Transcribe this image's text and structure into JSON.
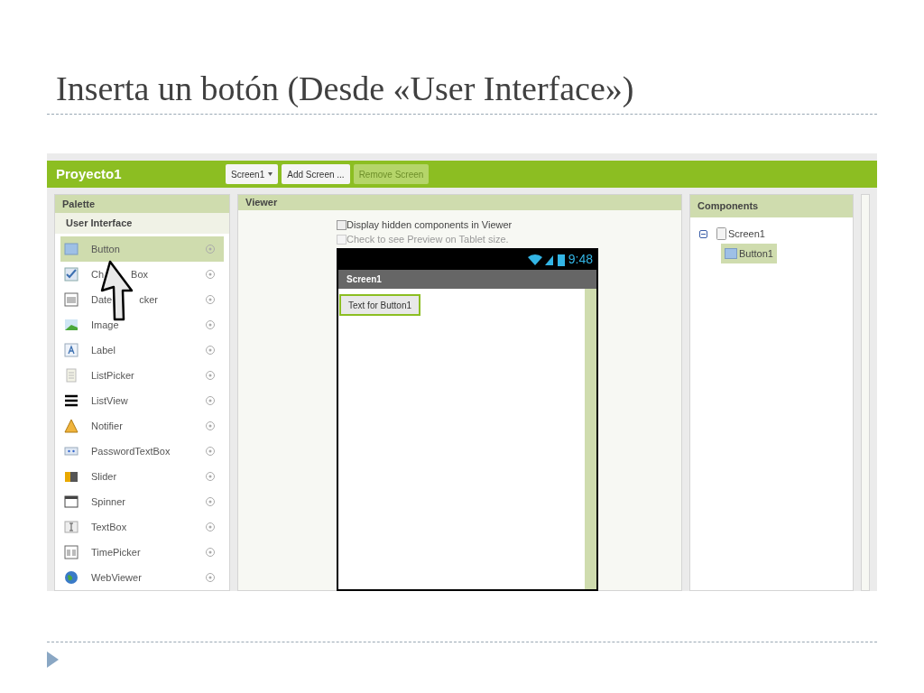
{
  "slide": {
    "title": "Inserta un botón (Desde «User Interface»)"
  },
  "app": {
    "project": "Proyecto1",
    "toolbar": [
      {
        "label": "Screen1",
        "kind": "dropdown",
        "disabled": false
      },
      {
        "label": "Add Screen ...",
        "kind": "button",
        "disabled": false
      },
      {
        "label": "Remove Screen",
        "kind": "button",
        "disabled": true
      }
    ],
    "palette": {
      "title": "Palette",
      "section": "User Interface",
      "items": [
        {
          "name": "Button",
          "kind": "button",
          "selected": true
        },
        {
          "name_parts": [
            "Ch",
            "Box"
          ],
          "kind": "checkbox",
          "selected": false
        },
        {
          "name_parts": [
            "Date",
            "cker"
          ],
          "kind": "datepicker",
          "selected": false
        },
        {
          "name": "Image",
          "kind": "image",
          "selected": false
        },
        {
          "name": "Label",
          "kind": "label",
          "selected": false
        },
        {
          "name": "ListPicker",
          "kind": "listpicker",
          "selected": false
        },
        {
          "name": "ListView",
          "kind": "listview",
          "selected": false
        },
        {
          "name": "Notifier",
          "kind": "notifier",
          "selected": false
        },
        {
          "name": "PasswordTextBox",
          "kind": "password",
          "selected": false
        },
        {
          "name": "Slider",
          "kind": "slider",
          "selected": false
        },
        {
          "name": "Spinner",
          "kind": "spinner",
          "selected": false
        },
        {
          "name": "TextBox",
          "kind": "textbox",
          "selected": false
        },
        {
          "name": "TimePicker",
          "kind": "timepicker",
          "selected": false
        },
        {
          "name": "WebViewer",
          "kind": "webviewer",
          "selected": false
        }
      ]
    },
    "viewer": {
      "title": "Viewer",
      "options": [
        {
          "label": "Display hidden components in Viewer",
          "checked": false,
          "disabled": false
        },
        {
          "label": "Check to see Preview on Tablet size.",
          "checked": false,
          "disabled": true
        }
      ],
      "phone": {
        "time": "9:48",
        "screen_title": "Screen1",
        "button": {
          "label": "Text for Button1",
          "selected": true
        }
      }
    },
    "components": {
      "title": "Components",
      "tree": [
        {
          "name": "Screen1",
          "kind": "screen",
          "expanded": true,
          "selected": false,
          "children": [
            {
              "name": "Button1",
              "kind": "button",
              "selected": true
            }
          ]
        }
      ]
    }
  }
}
